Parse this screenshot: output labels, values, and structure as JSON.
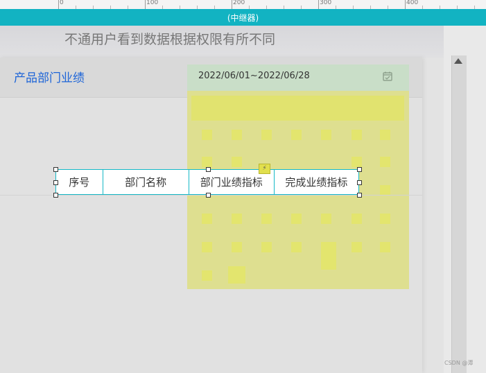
{
  "ruler": {
    "labels": [
      "0",
      "100",
      "200",
      "300",
      "400"
    ]
  },
  "top_bar": {
    "title": "(中继器)"
  },
  "page": {
    "subtitle": "不通用户看到数据根据权限有所不同"
  },
  "panel": {
    "title": "产品部门业绩",
    "date_range": "2022/06/01~2022/06/28"
  },
  "table": {
    "headers": [
      "序号",
      "部门名称",
      "部门业绩指标",
      "完成业绩指标"
    ]
  },
  "watermark": "CSDN @潭",
  "icons": {
    "calendar": "calendar-icon",
    "flash": "flash-icon",
    "scroll_up": "chevron-up-icon"
  },
  "colors": {
    "accent_teal": "#12b3c2",
    "title_blue": "#1c64d8",
    "date_green": "#c9dec8",
    "calendar_yellow": "#dedf90"
  }
}
